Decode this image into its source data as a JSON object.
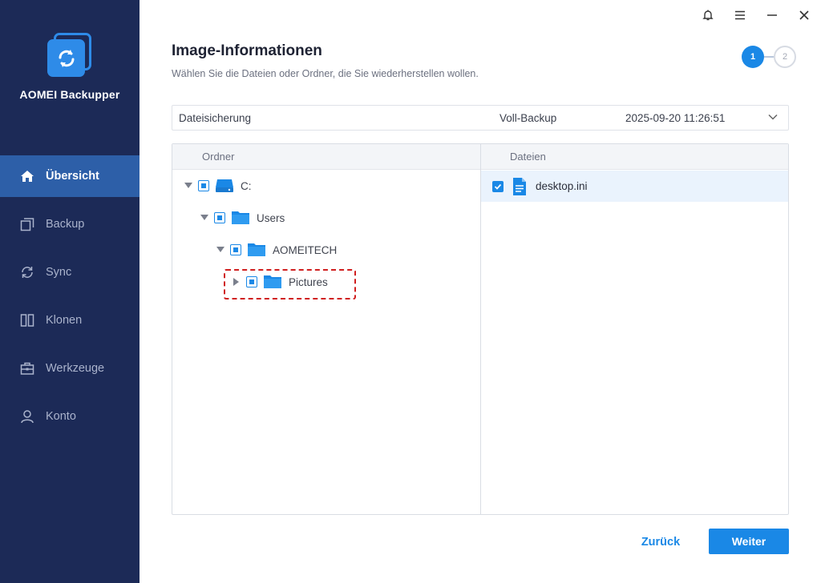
{
  "app": {
    "name": "AOMEI Backupper"
  },
  "sidebar": {
    "items": [
      {
        "label": "Übersicht",
        "icon": "home-icon",
        "active": true
      },
      {
        "label": "Backup",
        "icon": "backup-icon",
        "active": false
      },
      {
        "label": "Sync",
        "icon": "sync-icon",
        "active": false
      },
      {
        "label": "Klonen",
        "icon": "clone-icon",
        "active": false
      },
      {
        "label": "Werkzeuge",
        "icon": "toolbox-icon",
        "active": false
      },
      {
        "label": "Konto",
        "icon": "user-icon",
        "active": false
      }
    ]
  },
  "header": {
    "title": "Image-Informationen",
    "subtitle": "Wählen Sie die Dateien oder Ordner, die Sie wiederherstellen wollen.",
    "steps": [
      "1",
      "2"
    ],
    "current_step": 1
  },
  "backup": {
    "name": "Dateisicherung",
    "type": "Voll-Backup",
    "timestamp": "2025-09-20 11:26:51"
  },
  "folders": {
    "header": "Ordner",
    "tree": [
      {
        "label": "C:",
        "kind": "drive",
        "expanded": true
      },
      {
        "label": "Users",
        "kind": "folder",
        "expanded": true
      },
      {
        "label": "AOMEITECH",
        "kind": "folder",
        "expanded": true
      },
      {
        "label": "Pictures",
        "kind": "folder",
        "expanded": false
      }
    ]
  },
  "files": {
    "header": "Dateien",
    "items": [
      {
        "label": "desktop.ini",
        "checked": true
      }
    ]
  },
  "buttons": {
    "back": "Zurück",
    "next": "Weiter"
  },
  "colors": {
    "sidebar": "#1c2a57",
    "active_nav": "#2d5fa8",
    "accent": "#1a88e6",
    "highlight_border": "#d01f1f"
  }
}
